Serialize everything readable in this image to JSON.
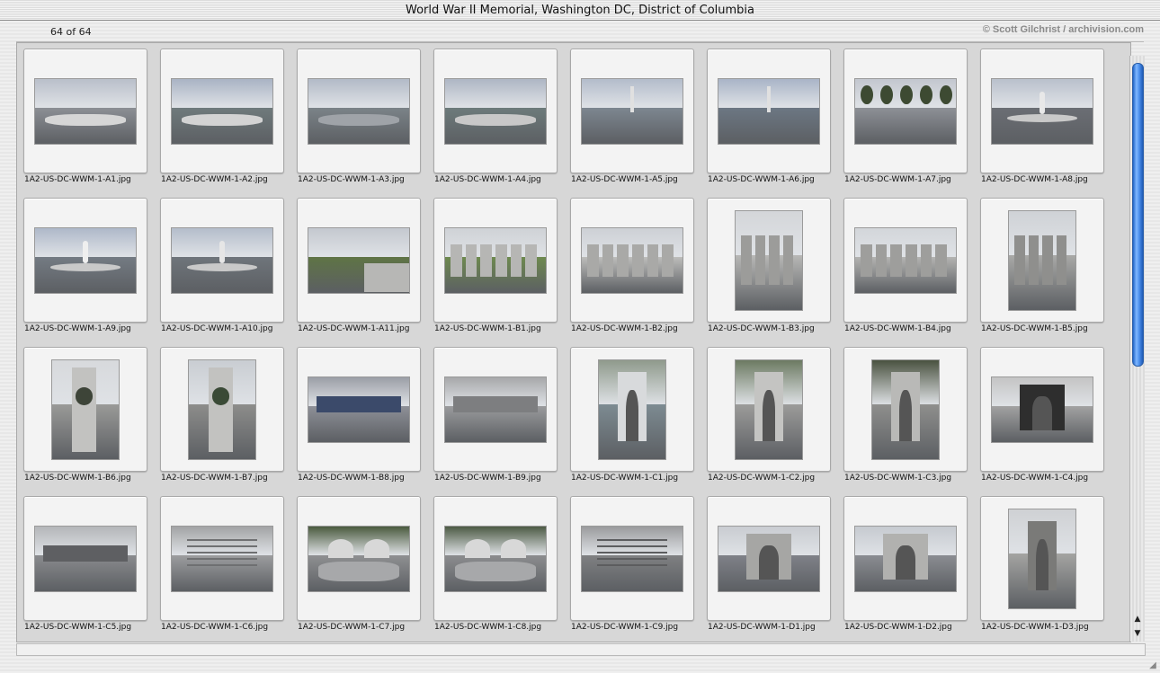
{
  "window": {
    "title": "World War II Memorial, Washington DC, District of Columbia"
  },
  "header": {
    "count_label": "64 of 64",
    "copyright": "© Scott Gilchrist / archivision.com"
  },
  "icons": {
    "scroll_up": "▲",
    "scroll_down": "▼",
    "resize_grip": "◢"
  },
  "thumbnails": [
    {
      "file": "1A2-US-DC-WWM-1-A1.jpg",
      "orient": "landscape",
      "kind": "plaza",
      "sky": "#b9bfca",
      "ground": "#8c8f95",
      "accent": "#d6d6d6"
    },
    {
      "file": "1A2-US-DC-WWM-1-A2.jpg",
      "orient": "landscape",
      "kind": "pool",
      "sky": "#a9b3c4",
      "ground": "#6f7a7c",
      "accent": "#d3d3d3"
    },
    {
      "file": "1A2-US-DC-WWM-1-A3.jpg",
      "orient": "landscape",
      "kind": "pool",
      "sky": "#b2bac7",
      "ground": "#7b8388",
      "accent": "#9fa3a8"
    },
    {
      "file": "1A2-US-DC-WWM-1-A4.jpg",
      "orient": "landscape",
      "kind": "pool",
      "sky": "#aeb6c4",
      "ground": "#6d7b7b",
      "accent": "#c8c8c8"
    },
    {
      "file": "1A2-US-DC-WWM-1-A5.jpg",
      "orient": "landscape",
      "kind": "monument",
      "sky": "#b3bccb",
      "ground": "#7d8790",
      "accent": "#e0e0e0"
    },
    {
      "file": "1A2-US-DC-WWM-1-A6.jpg",
      "orient": "landscape",
      "kind": "monument",
      "sky": "#a9b4c7",
      "ground": "#6c7783",
      "accent": "#e0e0e0"
    },
    {
      "file": "1A2-US-DC-WWM-1-A7.jpg",
      "orient": "landscape",
      "kind": "trees",
      "sky": "#c3c7cf",
      "ground": "#8d9096",
      "accent": "#3d4a32"
    },
    {
      "file": "1A2-US-DC-WWM-1-A8.jpg",
      "orient": "landscape",
      "kind": "fountain",
      "sky": "#b9c0cc",
      "ground": "#6b6e74",
      "accent": "#e8e8e8"
    },
    {
      "file": "1A2-US-DC-WWM-1-A9.jpg",
      "orient": "landscape",
      "kind": "fountain",
      "sky": "#aeb8c9",
      "ground": "#747b83",
      "accent": "#efefef"
    },
    {
      "file": "1A2-US-DC-WWM-1-A10.jpg",
      "orient": "landscape",
      "kind": "fountain",
      "sky": "#b4bdcb",
      "ground": "#6f757b",
      "accent": "#e6e6e6"
    },
    {
      "file": "1A2-US-DC-WWM-1-A11.jpg",
      "orient": "landscape",
      "kind": "lawn",
      "sky": "#c4c8cf",
      "ground": "#5f7445",
      "accent": "#b7b7b5"
    },
    {
      "file": "1A2-US-DC-WWM-1-B1.jpg",
      "orient": "landscape",
      "kind": "pillars",
      "sky": "#cfd2d6",
      "ground": "#6e8a4f",
      "accent": "#b6b6b4"
    },
    {
      "file": "1A2-US-DC-WWM-1-B2.jpg",
      "orient": "landscape",
      "kind": "pillars",
      "sky": "#cdd0d5",
      "ground": "#bdbdbb",
      "accent": "#a9a9a7"
    },
    {
      "file": "1A2-US-DC-WWM-1-B3.jpg",
      "orient": "portrait",
      "kind": "pillars",
      "sky": "#d4d6d9",
      "ground": "#b8b8b6",
      "accent": "#9c9c9a"
    },
    {
      "file": "1A2-US-DC-WWM-1-B4.jpg",
      "orient": "landscape",
      "kind": "pillars",
      "sky": "#d3d6da",
      "ground": "#b4b4b2",
      "accent": "#9e9e9c"
    },
    {
      "file": "1A2-US-DC-WWM-1-B5.jpg",
      "orient": "portrait",
      "kind": "pillars",
      "sky": "#cfd2d6",
      "ground": "#a9a9a7",
      "accent": "#8f8f8d"
    },
    {
      "file": "1A2-US-DC-WWM-1-B6.jpg",
      "orient": "portrait",
      "kind": "column",
      "sky": "#d7d9dc",
      "ground": "#9a9a98",
      "accent": "#3d4438"
    },
    {
      "file": "1A2-US-DC-WWM-1-B7.jpg",
      "orient": "portrait",
      "kind": "column",
      "sky": "#c9cdd2",
      "ground": "#8d8d8b",
      "accent": "#3a4a36"
    },
    {
      "file": "1A2-US-DC-WWM-1-B8.jpg",
      "orient": "landscape",
      "kind": "stone",
      "sky": "#9b9ea6",
      "ground": "#8e9098",
      "accent": "#3b4a6a"
    },
    {
      "file": "1A2-US-DC-WWM-1-B9.jpg",
      "orient": "landscape",
      "kind": "stone",
      "sky": "#a7a8aa",
      "ground": "#9a9b9d",
      "accent": "#7d7e80"
    },
    {
      "file": "1A2-US-DC-WWM-1-C1.jpg",
      "orient": "portrait",
      "kind": "arch",
      "sky": "#8f9a8c",
      "ground": "#7d8b92",
      "accent": "#d8dadc"
    },
    {
      "file": "1A2-US-DC-WWM-1-C2.jpg",
      "orient": "portrait",
      "kind": "arch",
      "sky": "#6c7a62",
      "ground": "#9c9c9a",
      "accent": "#c4c4c2"
    },
    {
      "file": "1A2-US-DC-WWM-1-C3.jpg",
      "orient": "portrait",
      "kind": "arch",
      "sky": "#4a5240",
      "ground": "#8f8f8d",
      "accent": "#b9b9b7"
    },
    {
      "file": "1A2-US-DC-WWM-1-C4.jpg",
      "orient": "landscape",
      "kind": "arch",
      "sky": "#c4c4c4",
      "ground": "#a2a2a2",
      "accent": "#2e2e2e"
    },
    {
      "file": "1A2-US-DC-WWM-1-C5.jpg",
      "orient": "landscape",
      "kind": "stone",
      "sky": "#b4b6b9",
      "ground": "#8a8b8e",
      "accent": "#5e5f62"
    },
    {
      "file": "1A2-US-DC-WWM-1-C6.jpg",
      "orient": "landscape",
      "kind": "inscription",
      "sky": "#a2a3a5",
      "ground": "#9c9d9f",
      "accent": "#6f7072"
    },
    {
      "file": "1A2-US-DC-WWM-1-C7.jpg",
      "orient": "landscape",
      "kind": "fountain-stone",
      "sky": "#4a5a3e",
      "ground": "#8f9092",
      "accent": "#d8d8d8"
    },
    {
      "file": "1A2-US-DC-WWM-1-C8.jpg",
      "orient": "landscape",
      "kind": "fountain-stone",
      "sky": "#4c5a44",
      "ground": "#8c8d8f",
      "accent": "#d8d8d8"
    },
    {
      "file": "1A2-US-DC-WWM-1-C9.jpg",
      "orient": "landscape",
      "kind": "inscription",
      "sky": "#9a9b9d",
      "ground": "#7f8082",
      "accent": "#5c5d5f"
    },
    {
      "file": "1A2-US-DC-WWM-1-D1.jpg",
      "orient": "landscape",
      "kind": "arch",
      "sky": "#c9ccd1",
      "ground": "#7f8188",
      "accent": "#a6a6a4"
    },
    {
      "file": "1A2-US-DC-WWM-1-D2.jpg",
      "orient": "landscape",
      "kind": "arch",
      "sky": "#c6cad0",
      "ground": "#8b8d92",
      "accent": "#b1b1af"
    },
    {
      "file": "1A2-US-DC-WWM-1-D3.jpg",
      "orient": "portrait",
      "kind": "arch",
      "sky": "#cfd1d4",
      "ground": "#a4a4a2",
      "accent": "#7a7a78"
    }
  ]
}
